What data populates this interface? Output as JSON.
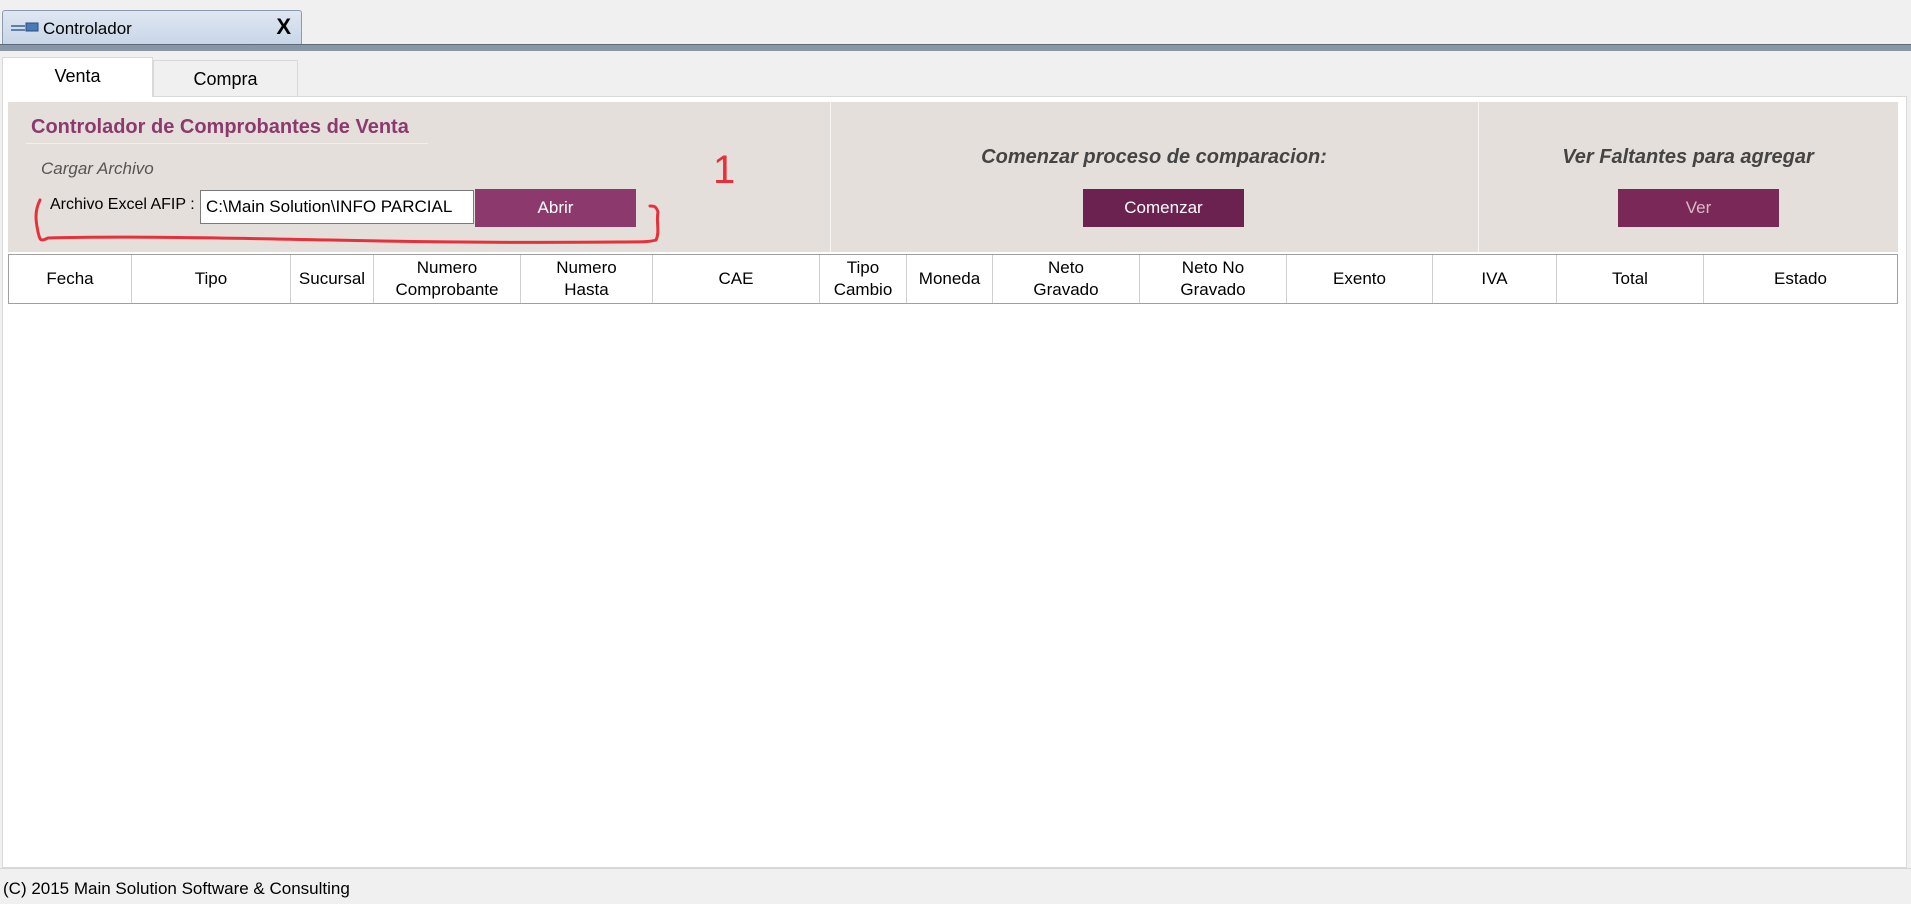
{
  "window": {
    "doc_tab_title": "Controlador",
    "close_glyph": "X"
  },
  "tabs": [
    {
      "label": "Venta",
      "active": true
    },
    {
      "label": "Compra",
      "active": false
    }
  ],
  "load_panel": {
    "title": "Controlador de Comprobantes de Venta",
    "subtitle": "Cargar Archivo",
    "field_label": "Archivo Excel AFIP :",
    "field_value": "C:\\Main Solution\\INFO PARCIAL",
    "open_button": "Abrir"
  },
  "compare_panel": {
    "title": "Comenzar proceso de comparacion:",
    "button": "Comenzar"
  },
  "missing_panel": {
    "title": "Ver Faltantes para agregar",
    "button": "Ver"
  },
  "annotation": {
    "marker": "1",
    "color": "#e8303a"
  },
  "grid": {
    "columns": [
      "Fecha",
      "Tipo",
      "Sucursal",
      "Numero\nComprobante",
      "Numero\nHasta",
      "CAE",
      "Tipo\nCambio",
      "Moneda",
      "Neto\nGravado",
      "Neto No\nGravado",
      "Exento",
      "IVA",
      "Total",
      "Estado"
    ],
    "rows": []
  },
  "status_bar": {
    "text": "(C) 2015 Main Solution Software & Consulting"
  },
  "colors": {
    "accent": "#8c3a6e",
    "panel_bg": "#e4dfdb",
    "button_dark": "#6b2251"
  }
}
